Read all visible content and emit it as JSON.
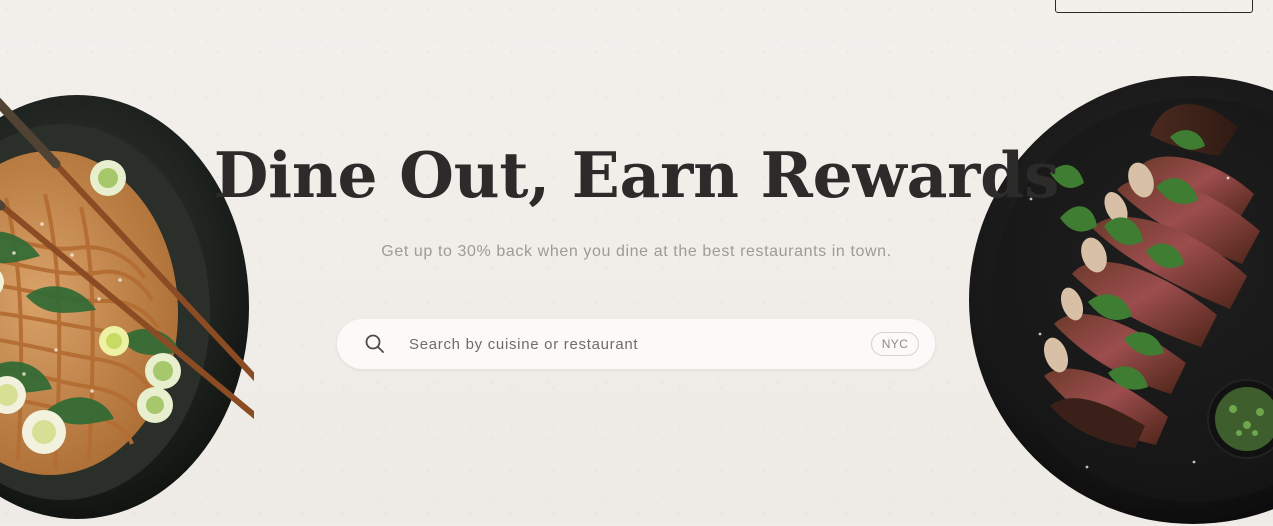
{
  "hero": {
    "headline": "Dine Out, Earn Rewards",
    "subheadline": "Get up to 30% back when you dine at the best restaurants in town."
  },
  "search": {
    "placeholder": "Search by cuisine or restaurant",
    "city": "NYC",
    "icon": "search-icon"
  },
  "images": {
    "left": "noodle-bowl-image",
    "right": "steak-plate-image"
  },
  "colors": {
    "background": "#f1eeea",
    "headline": "#2d2b29",
    "subheadline": "#9e9a96",
    "search_bg": "#fbfaf8"
  }
}
